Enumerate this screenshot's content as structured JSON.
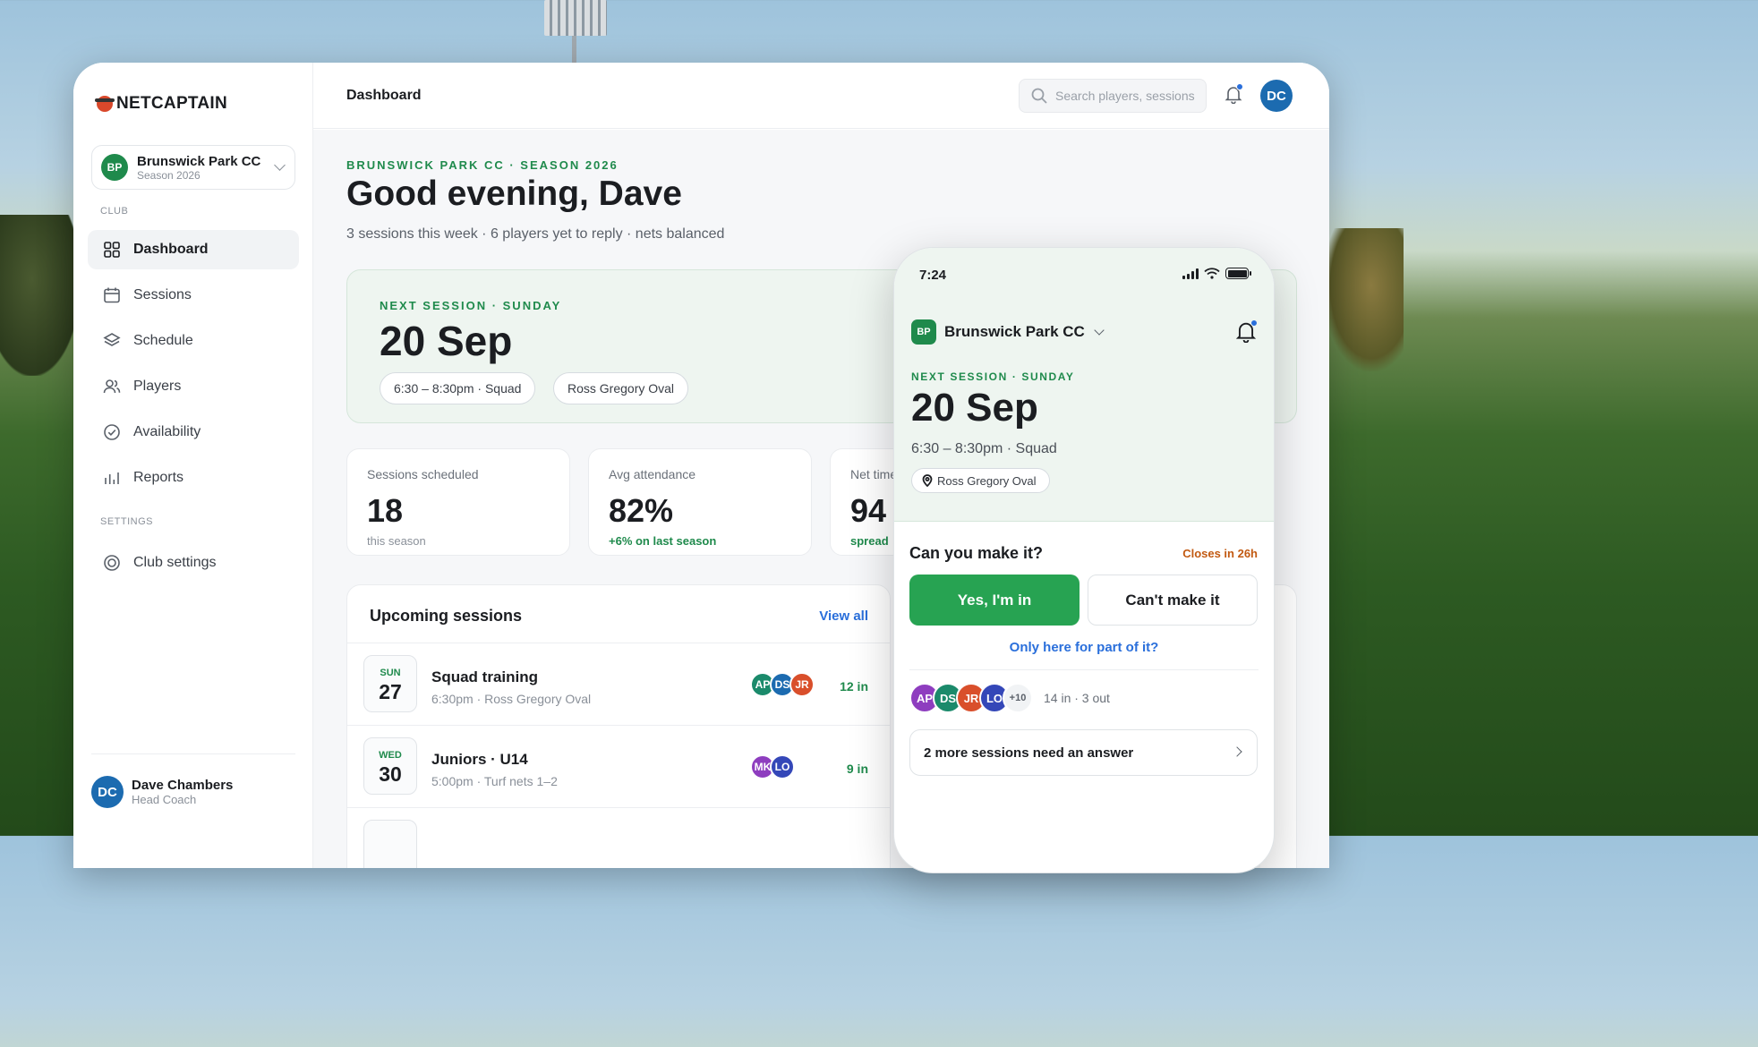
{
  "app": {
    "brand": "NETCAPTAIN",
    "page_title": "Dashboard"
  },
  "club": {
    "initials": "BP",
    "name": "Brunswick Park CC",
    "season": "Season 2026"
  },
  "sidebar": {
    "section_club": "CLUB",
    "section_settings": "SETTINGS",
    "items": [
      {
        "label": "Dashboard",
        "icon": "grid-icon",
        "active": true
      },
      {
        "label": "Sessions",
        "icon": "calendar-icon"
      },
      {
        "label": "Schedule",
        "icon": "layers-icon"
      },
      {
        "label": "Players",
        "icon": "users-icon"
      },
      {
        "label": "Availability",
        "icon": "check-circle-icon"
      },
      {
        "label": "Reports",
        "icon": "bar-chart-icon"
      }
    ],
    "settings_items": [
      {
        "label": "Club settings",
        "icon": "settings-icon"
      }
    ]
  },
  "user": {
    "initials": "DC",
    "name": "Dave Chambers",
    "role": "Head Coach"
  },
  "search": {
    "placeholder": "Search players, sessions"
  },
  "hero": {
    "eyebrow": "BRUNSWICK PARK CC · SEASON 2026",
    "greeting": "Good evening, Dave",
    "summary": "3 sessions this week · 6 players yet to reply · nets balanced"
  },
  "next_session": {
    "eyebrow": "NEXT SESSION · SUNDAY",
    "date": "20 Sep",
    "time_pill": "6:30 – 8:30pm · Squad",
    "venue_pill": "Ross Gregory Oval"
  },
  "stats": [
    {
      "label": "Sessions scheduled",
      "value": "18",
      "sub": "this season"
    },
    {
      "label": "Avg attendance",
      "value": "82%",
      "sub": "+6% on last season"
    },
    {
      "label": "Net time",
      "value": "94",
      "sub": "spread"
    }
  ],
  "upcoming": {
    "title": "Upcoming sessions",
    "view_all": "View all",
    "rows": [
      {
        "dow": "SUN",
        "day": "27",
        "title": "Squad training",
        "sub": "6:30pm · Ross Gregory Oval",
        "avatars": [
          "AP",
          "DS",
          "JR"
        ],
        "count": "12 in"
      },
      {
        "dow": "WED",
        "day": "30",
        "title": "Juniors · U14",
        "sub": "5:00pm · Turf nets 1–2",
        "avatars": [
          "MK",
          "LO"
        ],
        "count": "9 in"
      }
    ]
  },
  "phone": {
    "time": "7:24",
    "club_initials": "BP",
    "club_name": "Brunswick Park CC",
    "eyebrow": "NEXT SESSION · SUNDAY",
    "date": "20 Sep",
    "time_line": "6:30 – 8:30pm · Squad",
    "venue": "Ross Gregory Oval",
    "question": "Can you make it?",
    "closes": "Closes in 26h",
    "yes_label": "Yes, I'm in",
    "no_label": "Can't make it",
    "partial_link": "Only here for part of it?",
    "avatars": [
      "AP",
      "DS",
      "JR",
      "LO"
    ],
    "more_count": "+10",
    "tally": "14 in · 3 out",
    "more_sessions": "2 more sessions need an answer"
  },
  "colors": {
    "accent_green": "#1f8a4c",
    "button_green": "#27a352",
    "link_blue": "#2a6fdb",
    "warning": "#c25a12",
    "avatar_blue": "#1c6bb0"
  }
}
